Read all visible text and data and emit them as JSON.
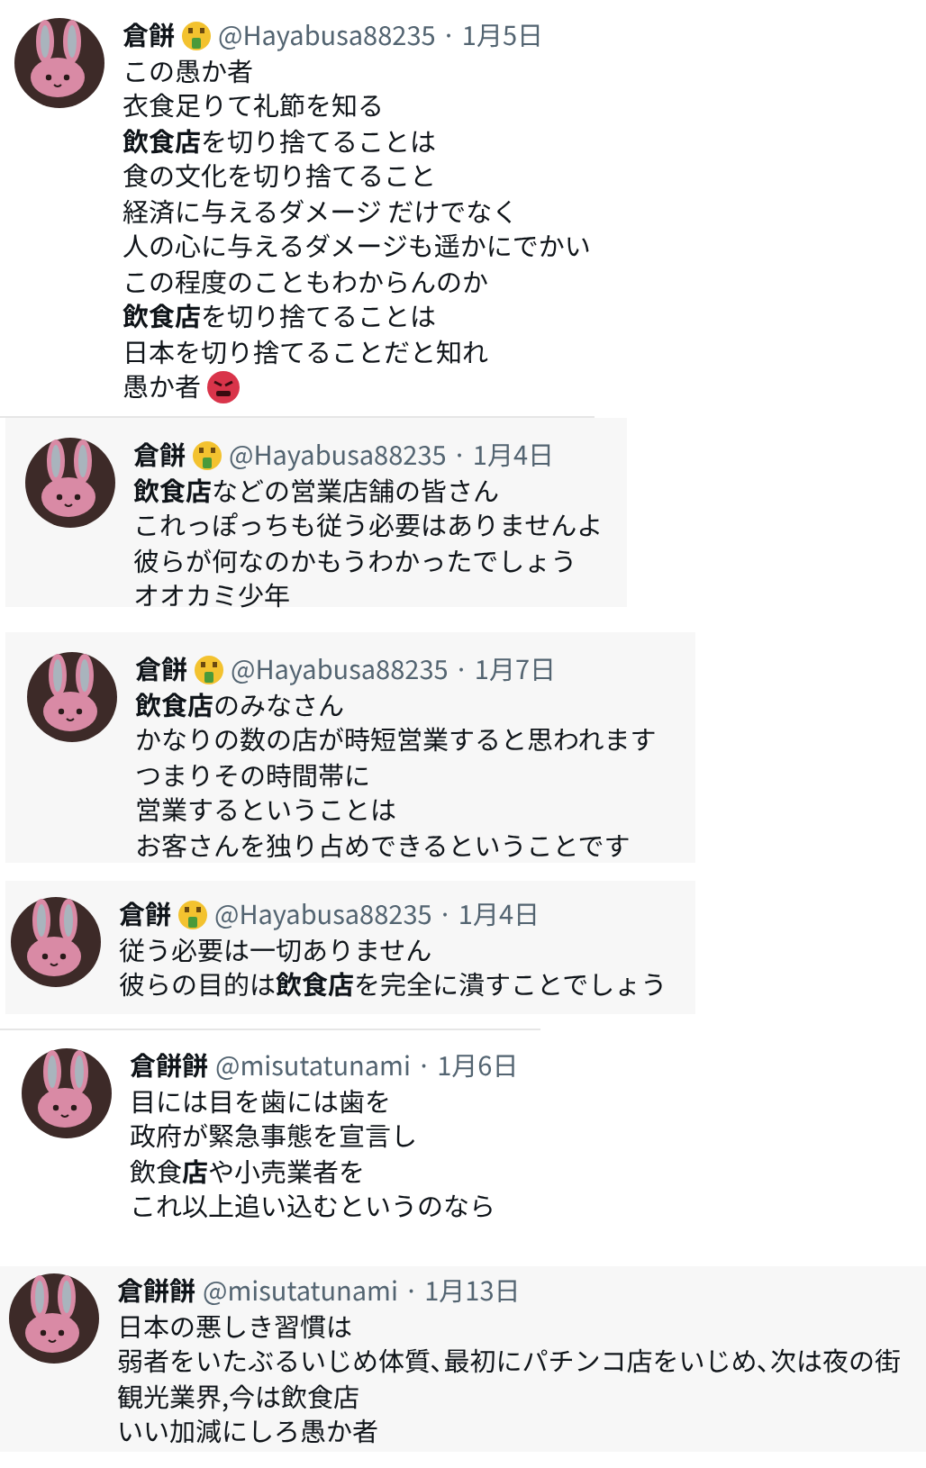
{
  "tweets": [
    {
      "kind": "plain",
      "name": "倉餅",
      "badge": true,
      "meta": "@Hayabusa88235 · 1月5日",
      "lines": [
        "この愚か者",
        "衣食足りて礼節を知る",
        "**飲食店**を切り捨てることは",
        "食の文化を切り捨てること",
        "経済に与えるダメージ だけでなく",
        "人の心に与えるダメージも遥かにでかい",
        "この程度のこともわからんのか",
        "**飲食店**を切り捨てることは",
        "日本を切り捨てることだと知れ",
        "愚か者"
      ],
      "trailing_emoji": true
    },
    {
      "kind": "card",
      "name": "倉餅",
      "badge": true,
      "meta": "@Hayabusa88235 · 1月4日",
      "lines": [
        "**飲食店**などの営業店舗の皆さん",
        "これっぽっちも従う必要はありませんよ",
        "彼らが何なのかもうわかったでしょう",
        "オオカミ少年"
      ]
    },
    {
      "kind": "card",
      "name": "倉餅",
      "badge": true,
      "meta": "@Hayabusa88235 · 1月7日",
      "lines": [
        "**飲食店**のみなさん",
        "かなりの数の店が時短営業すると思われます",
        "つまりその時間帯に",
        "営業するということは",
        "お客さんを独り占めできるということです"
      ]
    },
    {
      "kind": "card",
      "name": "倉餅",
      "badge": true,
      "meta": "@Hayabusa88235 · 1月4日",
      "lines": [
        "従う必要は一切ありません",
        "彼らの目的は**飲食店**を完全に潰すことでしょう"
      ]
    },
    {
      "kind": "plain",
      "name": "倉餅餅",
      "badge": false,
      "meta": "@misutatunami · 1月6日",
      "lines": [
        "目には目を歯には歯を",
        "政府が緊急事態を宣言し",
        "飲食**店**や小売業者を",
        "これ以上追い込むというのなら"
      ]
    },
    {
      "kind": "card",
      "name": "倉餅餅",
      "badge": false,
      "meta": "@misutatunami · 1月13日",
      "lines": [
        "日本の悪しき習慣は",
        "弱者をいたぶるいじめ体質､最初にパチンコ店をいじめ､次は夜の街",
        "観光業界,今は飲食店",
        "いい加減にしろ愚か者"
      ]
    }
  ]
}
